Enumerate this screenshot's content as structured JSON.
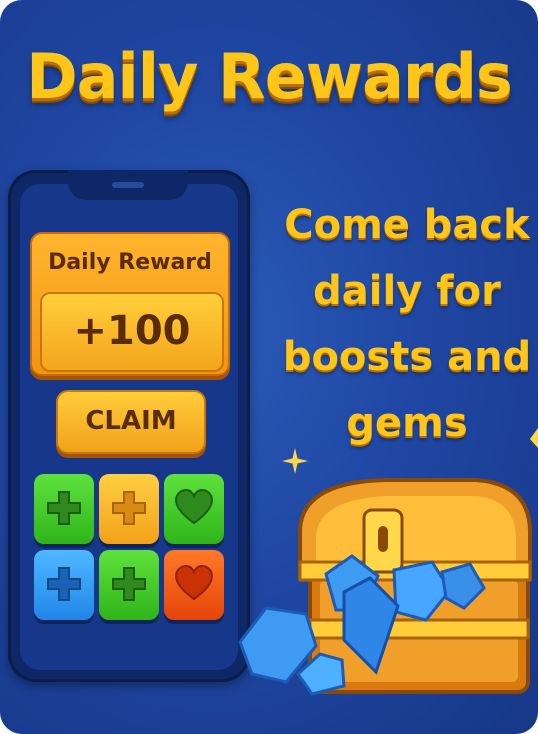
{
  "header": {
    "title": "Daily Rewards"
  },
  "promo": {
    "lines": [
      "Come back",
      "daily for",
      "boosts and",
      "gems"
    ]
  },
  "phone": {
    "reward_label": "Daily Reward",
    "reward_value": "+100",
    "claim_label": "CLAIM",
    "tiles": [
      {
        "type": "plus",
        "color": "green"
      },
      {
        "type": "plus",
        "color": "orange"
      },
      {
        "type": "heart",
        "color": "green"
      },
      {
        "type": "plus",
        "color": "blue"
      },
      {
        "type": "plus",
        "color": "green"
      },
      {
        "type": "heart",
        "color": "red"
      }
    ]
  },
  "colors": {
    "background": "#1f47a3",
    "accent_yellow": "#ffc61a",
    "button_orange": "#f2a21a"
  },
  "icons": [
    "plus-icon",
    "heart-icon",
    "sparkle-icon",
    "treasure-chest-icon",
    "gem-icon"
  ]
}
